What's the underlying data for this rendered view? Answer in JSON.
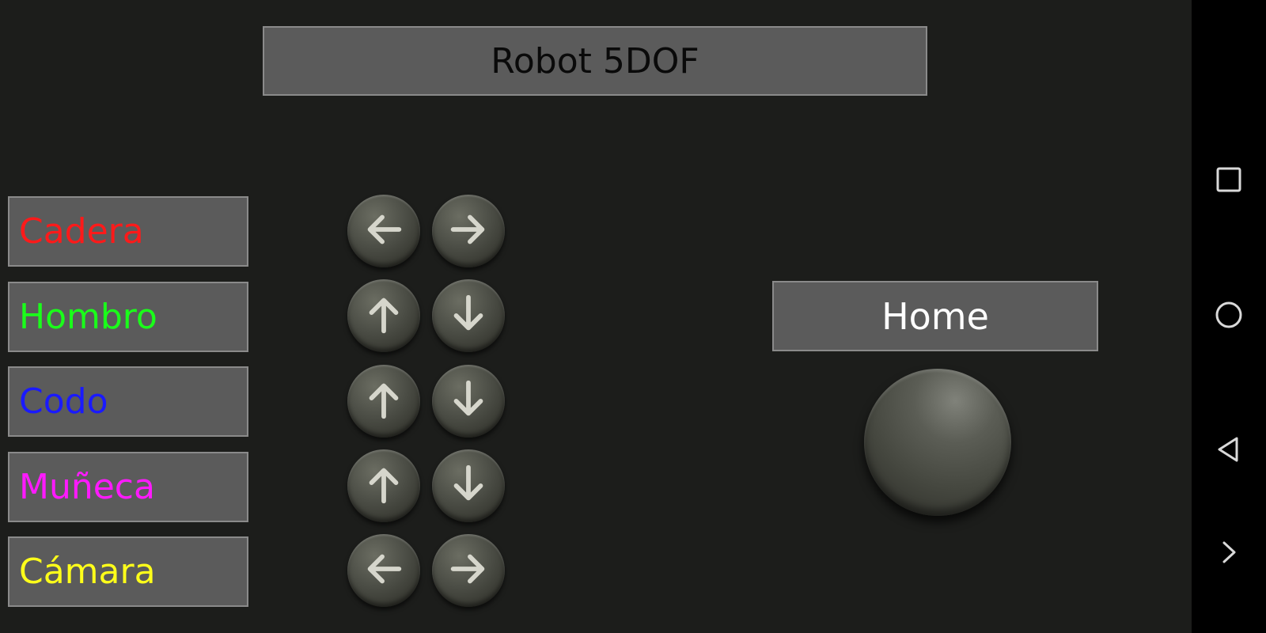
{
  "app": {
    "title": "Robot 5DOF"
  },
  "joints": [
    {
      "label": "Cadera",
      "color": "#ff1a1a",
      "buttons": [
        "arrow-left",
        "arrow-right"
      ]
    },
    {
      "label": "Hombro",
      "color": "#1aff1a",
      "buttons": [
        "arrow-up",
        "arrow-down"
      ]
    },
    {
      "label": "Codo",
      "color": "#1a1aff",
      "buttons": [
        "arrow-up",
        "arrow-down"
      ]
    },
    {
      "label": "Muñeca",
      "color": "#ff1aff",
      "buttons": [
        "arrow-up",
        "arrow-down"
      ]
    },
    {
      "label": "Cámara",
      "color": "#ffff1a",
      "buttons": [
        "arrow-left",
        "arrow-right"
      ]
    }
  ],
  "home": {
    "label": "Home"
  },
  "nav": {
    "icons": [
      "square-icon",
      "circle-icon",
      "triangle-back-icon",
      "chevron-right-icon"
    ]
  }
}
